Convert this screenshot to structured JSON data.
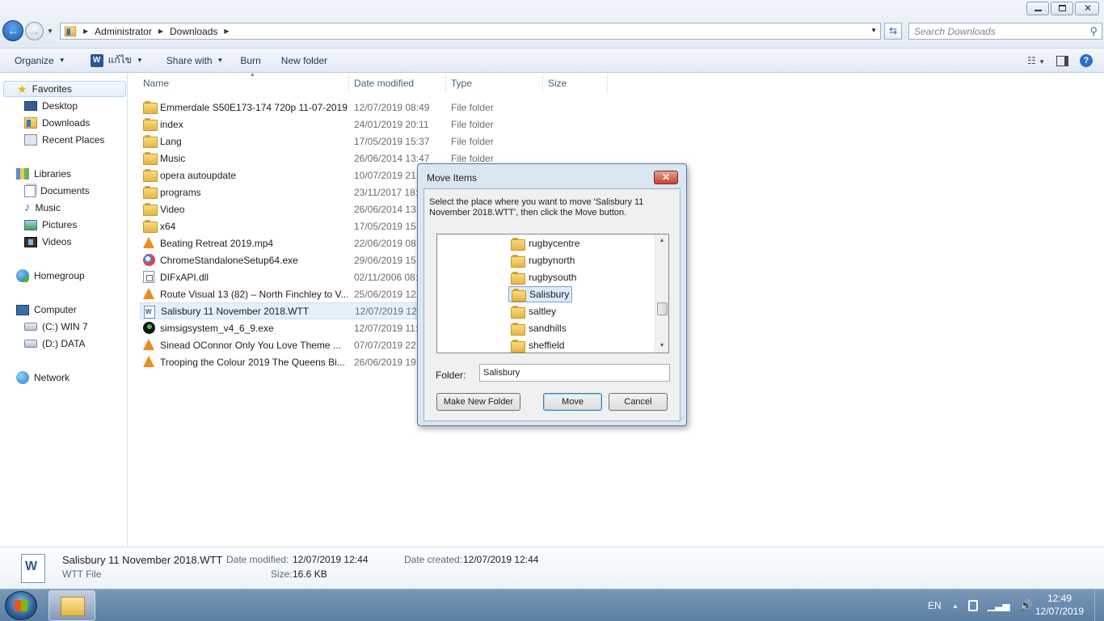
{
  "address": {
    "crumbs": [
      "Administrator",
      "Downloads"
    ],
    "search_placeholder": "Search Downloads"
  },
  "toolbar": {
    "organize": "Organize",
    "open_with": "แก้ไข",
    "share_with": "Share with",
    "burn": "Burn",
    "new_folder": "New folder"
  },
  "sidebar": {
    "favorites": "Favorites",
    "desktop": "Desktop",
    "downloads": "Downloads",
    "recent": "Recent Places",
    "libraries": "Libraries",
    "documents": "Documents",
    "music": "Music",
    "pictures": "Pictures",
    "videos": "Videos",
    "homegroup": "Homegroup",
    "computer": "Computer",
    "drive_c": "(C:) WIN 7",
    "drive_d": "(D:) DATA",
    "network": "Network"
  },
  "columns": {
    "name": "Name",
    "date": "Date modified",
    "type": "Type",
    "size": "Size"
  },
  "files": [
    {
      "name": "Emmerdale S50E173-174 720p 11-07-2019...",
      "date": "12/07/2019 08:49",
      "type": "File folder",
      "icon": "folder-icon"
    },
    {
      "name": "index",
      "date": "24/01/2019 20:11",
      "type": "File folder",
      "icon": "folder-icon"
    },
    {
      "name": "Lang",
      "date": "17/05/2019 15:37",
      "type": "File folder",
      "icon": "folder-icon"
    },
    {
      "name": "Music",
      "date": "26/06/2014 13:47",
      "type": "File folder",
      "icon": "folder-icon"
    },
    {
      "name": "opera autoupdate",
      "date": "10/07/2019 21:5",
      "type": "",
      "icon": "folder-icon"
    },
    {
      "name": "programs",
      "date": "23/11/2017 18:",
      "type": "",
      "icon": "folder-icon"
    },
    {
      "name": "Video",
      "date": "26/06/2014 13:4",
      "type": "",
      "icon": "folder-icon"
    },
    {
      "name": "x64",
      "date": "17/05/2019 15:3",
      "type": "",
      "icon": "folder-icon"
    },
    {
      "name": "Beating Retreat 2019.mp4",
      "date": "22/06/2019 08:",
      "type": "",
      "icon": "vlc-icon"
    },
    {
      "name": "ChromeStandaloneSetup64.exe",
      "date": "29/06/2019 15:",
      "type": "",
      "icon": "chrome-icon"
    },
    {
      "name": "DIFxAPI.dll",
      "date": "02/11/2006 08:",
      "type": "",
      "icon": "dll-icon"
    },
    {
      "name": "Route Visual 13 (82) – North Finchley to V...",
      "date": "25/06/2019 12:",
      "type": "",
      "icon": "vlc-icon"
    },
    {
      "name": "Salisbury 11 November 2018.WTT",
      "date": "12/07/2019 12:",
      "type": "",
      "icon": "word-doc-icon"
    },
    {
      "name": "simsigsystem_v4_6_9.exe",
      "date": "12/07/2019 11:",
      "type": "",
      "icon": "simsig-icon"
    },
    {
      "name": "Sinead OConnor   Only You Love Theme ...",
      "date": "07/07/2019 22:",
      "type": "",
      "icon": "vlc-icon"
    },
    {
      "name": "Trooping the Colour 2019  The Queens Bi...",
      "date": "26/06/2019 19:",
      "type": "",
      "icon": "vlc-icon"
    }
  ],
  "details": {
    "filename": "Salisbury 11 November 2018.WTT",
    "filetype": "WTT File",
    "modified_label": "Date modified:",
    "modified": "12/07/2019 12:44",
    "created_label": "Date created:",
    "created": "12/07/2019 12:44",
    "size_label": "Size:",
    "size": "16.6 KB"
  },
  "dialog": {
    "title": "Move Items",
    "instruction": "Select the place where you want to move 'Salisbury 11 November 2018.WTT', then click the Move button.",
    "folders": [
      "rugbycentre",
      "rugbynorth",
      "rugbysouth",
      "Salisbury",
      "saltley",
      "sandhills",
      "sheffield"
    ],
    "selected_folder": "Salisbury",
    "folder_label": "Folder:",
    "folder_value": "Salisbury",
    "make_new_folder": "Make New Folder",
    "move": "Move",
    "cancel": "Cancel"
  },
  "taskbar": {
    "lang": "EN",
    "time": "12:49",
    "date": "12/07/2019"
  }
}
